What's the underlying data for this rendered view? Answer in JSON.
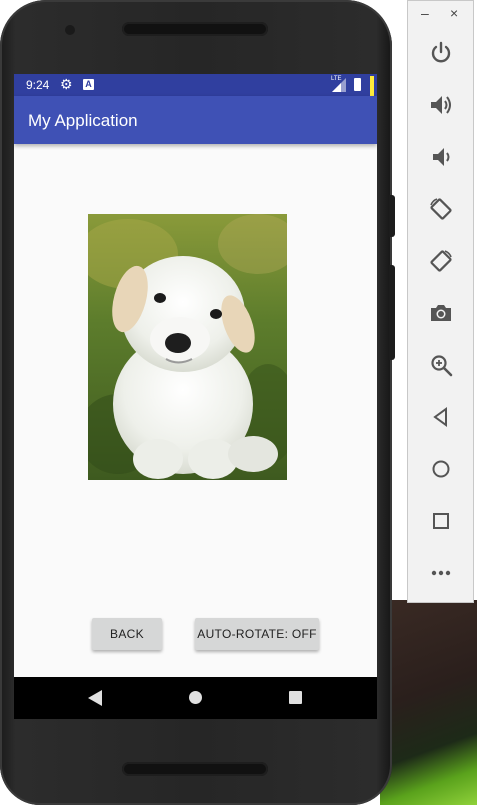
{
  "status_bar": {
    "time": "9:24",
    "network": "LTE",
    "color": "#303f9f"
  },
  "app": {
    "title": "My Application",
    "action_bar_color": "#3f51b5"
  },
  "buttons": {
    "back_label": "BACK",
    "auto_rotate_label": "AUTO-ROTATE: OFF"
  },
  "emulator_toolbar": {
    "minimize": "–",
    "close": "×",
    "tools": [
      "power-icon",
      "volume-up-icon",
      "volume-down-icon",
      "rotate-left-icon",
      "rotate-right-icon",
      "camera-icon",
      "zoom-icon",
      "back-icon",
      "home-icon",
      "overview-icon",
      "more-icon"
    ]
  }
}
